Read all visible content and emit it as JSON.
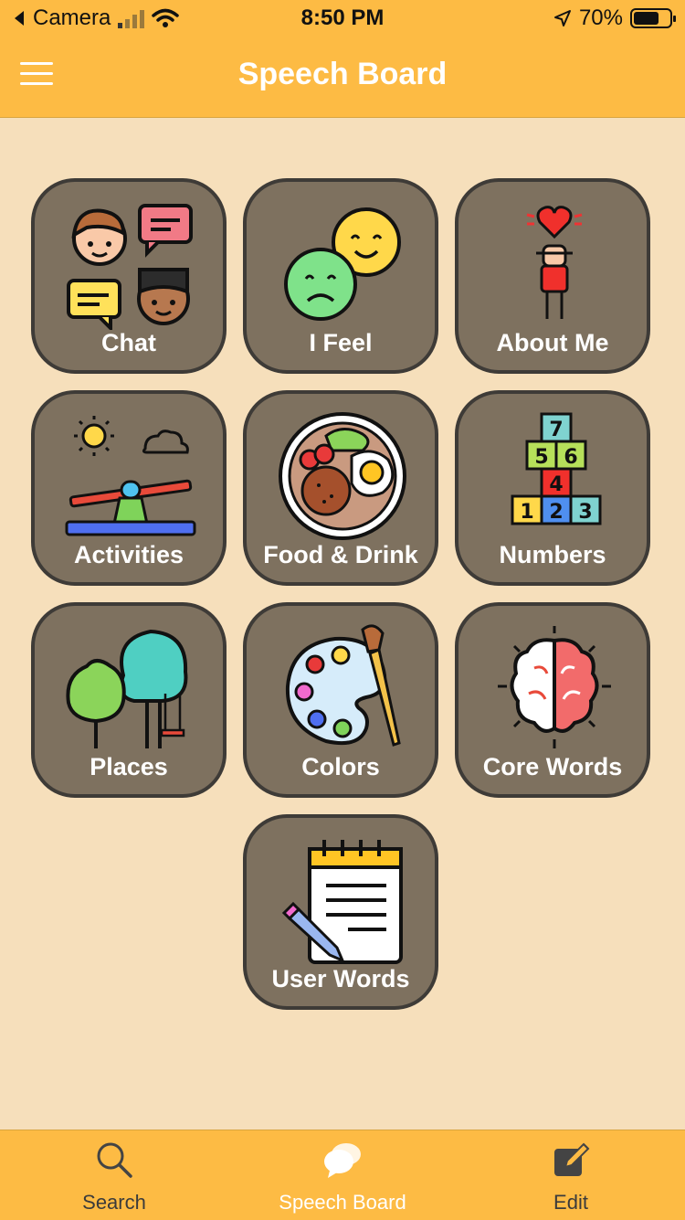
{
  "status_bar": {
    "back_label": "Camera",
    "time": "8:50 PM",
    "battery": "70%",
    "battery_level": 0.7
  },
  "header": {
    "title": "Speech Board",
    "menu_icon": "hamburger-icon"
  },
  "tiles": [
    {
      "label": "Chat",
      "icon": "chat-people-icon"
    },
    {
      "label": "I Feel",
      "icon": "emotion-faces-icon"
    },
    {
      "label": "About Me",
      "icon": "person-heart-icon"
    },
    {
      "label": "Activities",
      "icon": "seesaw-icon"
    },
    {
      "label": "Food & Drink",
      "icon": "food-plate-icon"
    },
    {
      "label": "Numbers",
      "icon": "hopscotch-numbers-icon"
    },
    {
      "label": "Places",
      "icon": "trees-swing-icon"
    },
    {
      "label": "Colors",
      "icon": "paint-palette-icon"
    },
    {
      "label": "Core Words",
      "icon": "brain-icon"
    },
    {
      "label": "User Words",
      "icon": "notepad-pencil-icon"
    }
  ],
  "tab_bar": {
    "items": [
      {
        "label": "Search",
        "icon": "search-icon",
        "active": false
      },
      {
        "label": "Speech Board",
        "icon": "speech-bubbles-icon",
        "active": true
      },
      {
        "label": "Edit",
        "icon": "edit-icon",
        "active": false
      }
    ]
  },
  "colors": {
    "accent": "#FDBB44",
    "background": "#F6DFBB",
    "tile": "#7E715F"
  }
}
